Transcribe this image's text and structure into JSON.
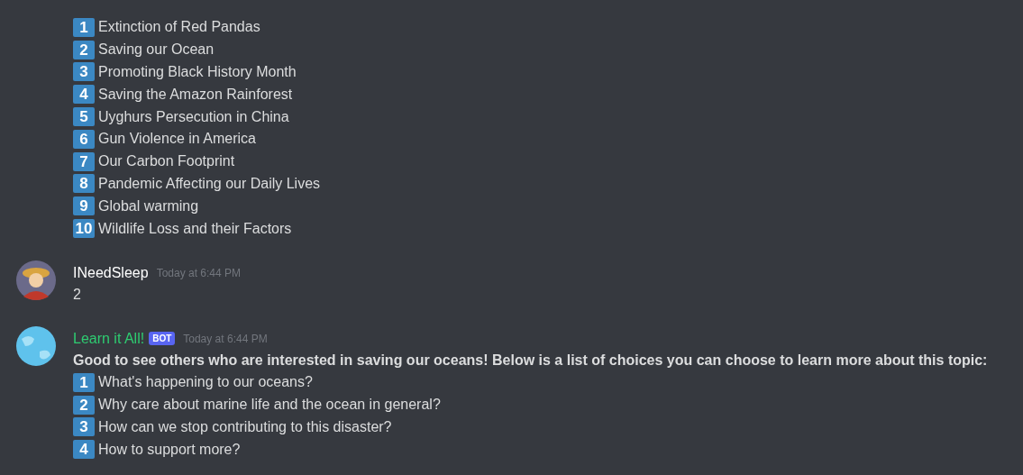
{
  "messages": [
    {
      "kind": "continuation",
      "items": [
        {
          "key": "1",
          "label": "Extinction of Red Pandas"
        },
        {
          "key": "2",
          "label": "Saving our Ocean"
        },
        {
          "key": "3",
          "label": "Promoting Black History Month"
        },
        {
          "key": "4",
          "label": "Saving the Amazon Rainforest"
        },
        {
          "key": "5",
          "label": "Uyghurs Persecution in China"
        },
        {
          "key": "6",
          "label": "Gun Violence in America"
        },
        {
          "key": "7",
          "label": "Our Carbon Footprint"
        },
        {
          "key": "8",
          "label": "Pandemic Affecting our Daily Lives"
        },
        {
          "key": "9",
          "label": "Global warming"
        },
        {
          "key": "10",
          "label": "Wildlife Loss and their Factors"
        }
      ]
    },
    {
      "kind": "user",
      "author": "INeedSleep",
      "color": "#ffffff",
      "timestamp": "Today at 6:44 PM",
      "text": "2"
    },
    {
      "kind": "bot",
      "author": "Learn it All!",
      "color": "#2ecc71",
      "badge": "BOT",
      "timestamp": "Today at 6:44 PM",
      "intro": "Good to see others who are interested in saving our oceans! Below is a list of choices you can choose to learn more about this topic:",
      "items": [
        {
          "key": "1",
          "label": "What's happening to our oceans?"
        },
        {
          "key": "2",
          "label": "Why care about marine life and the ocean in general?"
        },
        {
          "key": "3",
          "label": "How can we stop contributing to this disaster?"
        },
        {
          "key": "4",
          "label": "How to support more?"
        }
      ]
    }
  ]
}
